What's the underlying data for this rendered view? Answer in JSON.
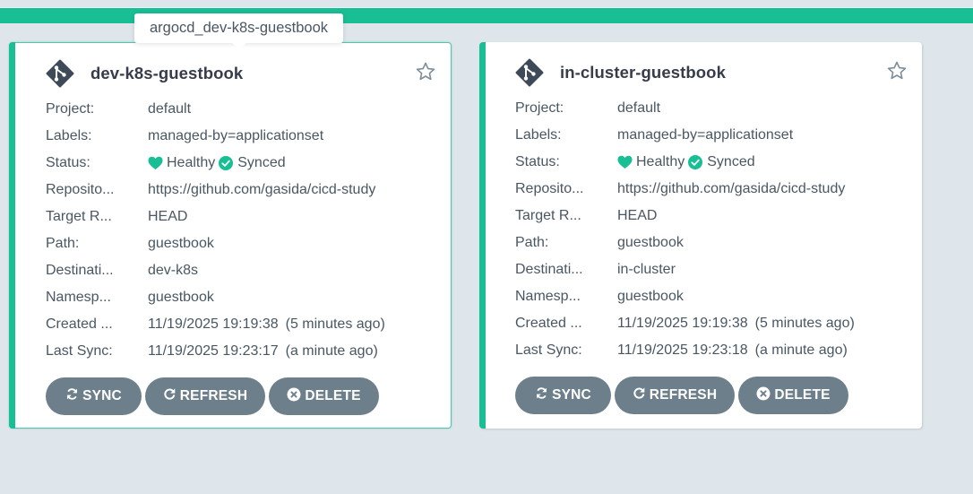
{
  "tooltip": {
    "text": "argocd_dev-k8s-guestbook"
  },
  "colors": {
    "accent": "#18be94",
    "button": "#6d7f8b",
    "background": "#dee6eb",
    "title": "#363c4a"
  },
  "icons": [
    "git-app-icon",
    "star-icon",
    "heart-icon",
    "check-circle-icon",
    "sync-icon",
    "refresh-icon",
    "delete-circle-icon"
  ],
  "cards": [
    {
      "title": "dev-k8s-guestbook",
      "fields": {
        "project": {
          "label": "Project:",
          "value": "default"
        },
        "labels": {
          "label": "Labels:",
          "value": "managed-by=applicationset"
        },
        "status": {
          "label": "Status:",
          "health": "Healthy",
          "sync": "Synced"
        },
        "repository": {
          "label": "Reposito...",
          "value": "https://github.com/gasida/cicd-study"
        },
        "target": {
          "label": "Target R...",
          "value": "HEAD"
        },
        "path": {
          "label": "Path:",
          "value": "guestbook"
        },
        "destination": {
          "label": "Destinati...",
          "value": "dev-k8s"
        },
        "namespace": {
          "label": "Namesp...",
          "value": "guestbook"
        },
        "created": {
          "label": "Created ...",
          "value": "11/19/2025 19:19:38",
          "relative": "(5 minutes ago)"
        },
        "last_sync": {
          "label": "Last Sync:",
          "value": "11/19/2025 19:23:17",
          "relative": "(a minute ago)"
        }
      },
      "buttons": {
        "sync": "SYNC",
        "refresh": "REFRESH",
        "delete": "DELETE"
      }
    },
    {
      "title": "in-cluster-guestbook",
      "fields": {
        "project": {
          "label": "Project:",
          "value": "default"
        },
        "labels": {
          "label": "Labels:",
          "value": "managed-by=applicationset"
        },
        "status": {
          "label": "Status:",
          "health": "Healthy",
          "sync": "Synced"
        },
        "repository": {
          "label": "Reposito...",
          "value": "https://github.com/gasida/cicd-study"
        },
        "target": {
          "label": "Target R...",
          "value": "HEAD"
        },
        "path": {
          "label": "Path:",
          "value": "guestbook"
        },
        "destination": {
          "label": "Destinati...",
          "value": "in-cluster"
        },
        "namespace": {
          "label": "Namesp...",
          "value": "guestbook"
        },
        "created": {
          "label": "Created ...",
          "value": "11/19/2025 19:19:38",
          "relative": "(5 minutes ago)"
        },
        "last_sync": {
          "label": "Last Sync:",
          "value": "11/19/2025 19:23:18",
          "relative": "(a minute ago)"
        }
      },
      "buttons": {
        "sync": "SYNC",
        "refresh": "REFRESH",
        "delete": "DELETE"
      }
    }
  ]
}
